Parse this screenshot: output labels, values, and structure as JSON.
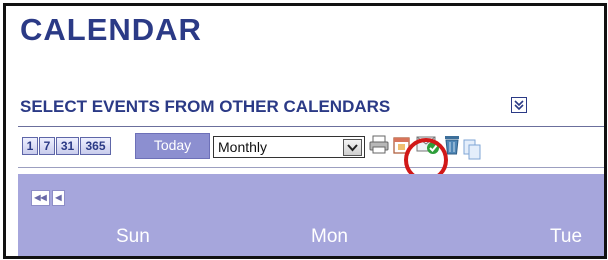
{
  "page": {
    "title": "CALENDAR"
  },
  "section": {
    "title": "SELECT EVENTS FROM OTHER CALENDARS"
  },
  "toolbar": {
    "view_buttons": [
      {
        "label": "1"
      },
      {
        "label": "7"
      },
      {
        "label": "31"
      },
      {
        "label": "365"
      }
    ],
    "today_label": "Today",
    "view_select": {
      "value": "Monthly"
    },
    "icons": [
      "print-icon",
      "calendar-icon",
      "select-events-icon",
      "trash-icon",
      "copy-icon"
    ]
  },
  "annotation": {
    "ring_color": "#d11818",
    "arrow_color": "#c00000"
  },
  "grid": {
    "nav": [
      {
        "label": "◀◀"
      },
      {
        "label": "◀"
      }
    ],
    "days": [
      {
        "label": "Sun"
      },
      {
        "label": "Mon"
      },
      {
        "label": "Tue"
      }
    ]
  },
  "colors": {
    "brand": "#2b3a86",
    "header_bg": "#a6a6dc",
    "today_bg": "#8c8fd0"
  }
}
